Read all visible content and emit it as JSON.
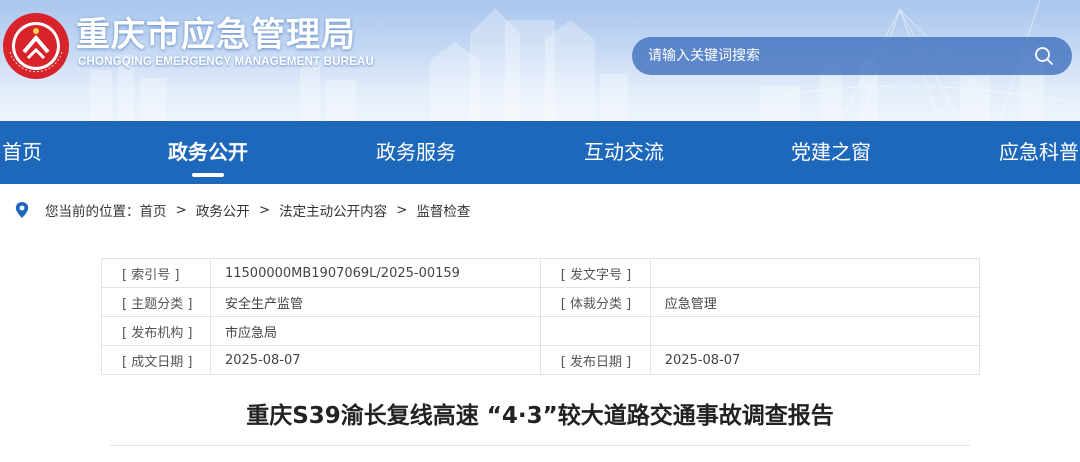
{
  "header": {
    "title": "重庆市应急管理局",
    "subtitle": "CHONGQING EMERGENCY MANAGEMENT BUREAU",
    "logo_ring_text": "CHINA EMERGENCY MANAGEMENT",
    "logo_ring_text_cn": "中国应急管理",
    "colors": {
      "banner_top": "#a9c6ee",
      "banner_bottom": "#eef4fc",
      "logo_red": "#d8232a"
    }
  },
  "search": {
    "placeholder": "请输入关键词搜索",
    "icon": "search-icon"
  },
  "nav": {
    "background": "#1e68bc",
    "items": [
      {
        "label": "首页",
        "active": false
      },
      {
        "label": "政务公开",
        "active": true
      },
      {
        "label": "政务服务",
        "active": false
      },
      {
        "label": "互动交流",
        "active": false
      },
      {
        "label": "党建之窗",
        "active": false
      },
      {
        "label": "应急科普",
        "active": false
      }
    ]
  },
  "breadcrumb": {
    "icon": "location-pin-icon",
    "prefix": "您当前的位置：",
    "items": [
      "首页",
      "政务公开",
      "法定主动公开内容",
      "监督检查"
    ],
    "separator": ">"
  },
  "meta": {
    "rows": [
      {
        "label1": "[ 索引号 ]",
        "value1": "11500000MB1907069L/2025-00159",
        "label2": "[ 发文字号 ]",
        "value2": ""
      },
      {
        "label1": "[ 主题分类 ]",
        "value1": "安全生产监管",
        "label2": "[ 体裁分类 ]",
        "value2": "应急管理"
      },
      {
        "label1": "[ 发布机构 ]",
        "value1": "市应急局",
        "label2": "",
        "value2": ""
      },
      {
        "label1": "[ 成文日期 ]",
        "value1": "2025-08-07",
        "label2": "[ 发布日期 ]",
        "value2": "2025-08-07"
      }
    ]
  },
  "article": {
    "title": "重庆S39渝长复线高速 “4·3”较大道路交通事故调查报告"
  }
}
